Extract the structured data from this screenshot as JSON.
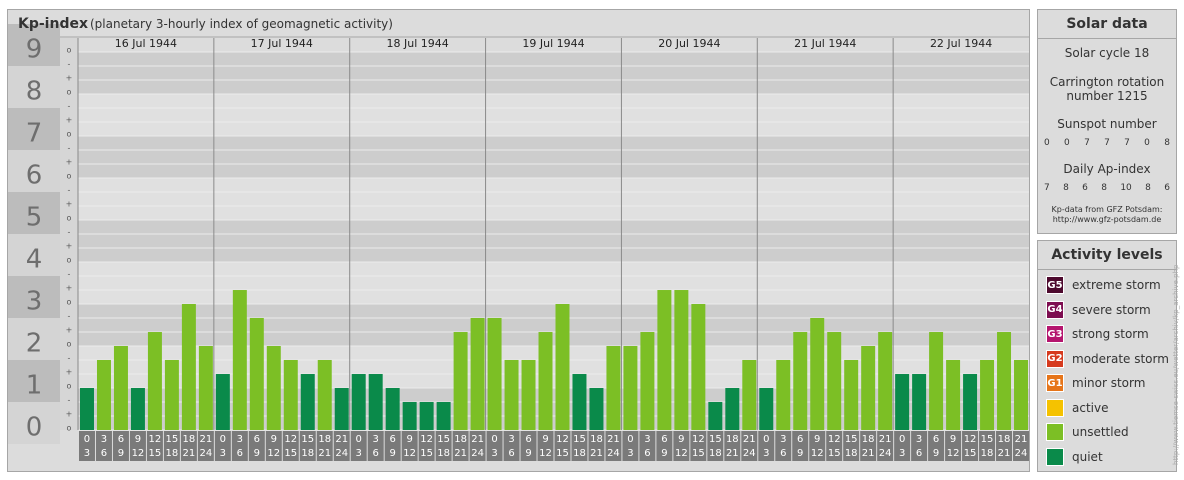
{
  "kp_panel": {
    "title": "Kp-index",
    "subtitle": "(planetary 3-hourly index of geomagnetic activity)"
  },
  "chart_data": {
    "type": "bar",
    "title": "Kp-index",
    "subtitle": "(planetary 3-hourly index of geomagnetic activity)",
    "ylim": [
      0,
      9
    ],
    "y_ticks": [
      "0",
      "1",
      "2",
      "3",
      "4",
      "5",
      "6",
      "7",
      "8",
      "9"
    ],
    "sub_ticks": [
      "o",
      "+",
      "-"
    ],
    "days": [
      "16 Jul 1944",
      "17 Jul 1944",
      "18 Jul 1944",
      "19 Jul 1944",
      "20 Jul 1944",
      "21 Jul 1944",
      "22 Jul 1944"
    ],
    "hour_labels": [
      [
        "0",
        "3"
      ],
      [
        "3",
        "6"
      ],
      [
        "6",
        "9"
      ],
      [
        "9",
        "12"
      ],
      [
        "12",
        "15"
      ],
      [
        "15",
        "18"
      ],
      [
        "18",
        "21"
      ],
      [
        "21",
        "24"
      ]
    ],
    "values": [
      [
        1.0,
        1.667,
        2.0,
        1.0,
        2.333,
        1.667,
        3.0,
        2.0
      ],
      [
        1.333,
        3.333,
        2.667,
        2.0,
        1.667,
        1.333,
        1.667,
        1.0
      ],
      [
        1.333,
        1.333,
        1.0,
        0.667,
        0.667,
        0.667,
        2.333,
        2.667
      ],
      [
        2.667,
        1.667,
        1.667,
        2.333,
        3.0,
        1.333,
        1.0,
        2.0
      ],
      [
        2.0,
        2.333,
        3.333,
        3.333,
        3.0,
        0.667,
        1.0,
        1.667
      ],
      [
        1.0,
        1.667,
        2.333,
        2.667,
        2.333,
        1.667,
        2.0,
        2.333
      ],
      [
        1.333,
        1.333,
        2.333,
        1.667,
        1.333,
        1.667,
        2.333,
        1.667
      ]
    ],
    "legend_position": "right",
    "grid": true
  },
  "solar_data": {
    "title": "Solar data",
    "solar_cycle": "Solar cycle 18",
    "carrington_line1": "Carrington rotation",
    "carrington_line2": "number 1215",
    "sunspot_label": "Sunspot number",
    "sunspot_values": [
      "0",
      "0",
      "7",
      "7",
      "7",
      "0",
      "8"
    ],
    "ap_label": "Daily Ap-index",
    "ap_values": [
      "7",
      "8",
      "6",
      "8",
      "10",
      "8",
      "6"
    ],
    "credit_line1": "Kp-data from GFZ Potsdam:",
    "credit_line2": "http://www.gfz-potsdam.de"
  },
  "activity_levels": {
    "title": "Activity levels",
    "items": [
      {
        "badge": "G5",
        "label": "extreme storm",
        "color": "#4d0a2e"
      },
      {
        "badge": "G4",
        "label": "severe storm",
        "color": "#7d0d50"
      },
      {
        "badge": "G3",
        "label": "strong storm",
        "color": "#b5156e"
      },
      {
        "badge": "G2",
        "label": "moderate storm",
        "color": "#d63a1e"
      },
      {
        "badge": "G1",
        "label": "minor storm",
        "color": "#e6751a"
      },
      {
        "badge": "",
        "label": "active",
        "color": "#f5c200"
      },
      {
        "badge": "",
        "label": "unsettled",
        "color": "#7cbf25"
      },
      {
        "badge": "",
        "label": "quiet",
        "color": "#0a8a4a"
      }
    ]
  },
  "colors": {
    "quiet": "#0a8a4a",
    "unsettled": "#7cbf25",
    "panel_bg": "#dcdcdc",
    "band_dark": "#cdcdcd",
    "band_light": "#e0e0e0",
    "axis_bg": "#7a7a7a"
  },
  "watermark": "http://www.tiemse-swiss.eu/wetter/archiv/kp_archive.php"
}
